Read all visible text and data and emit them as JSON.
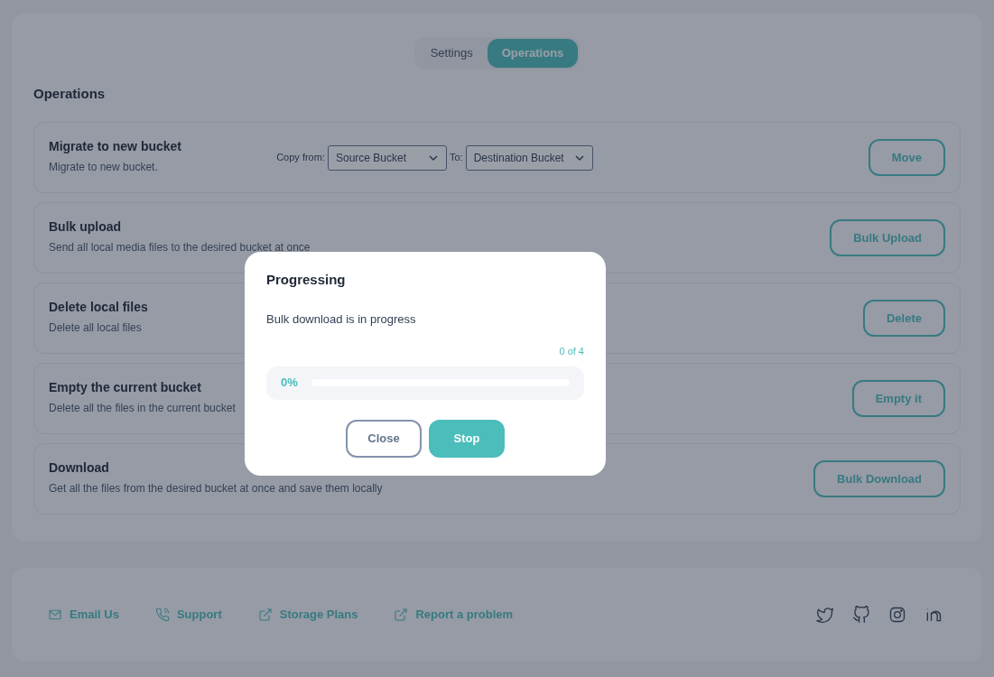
{
  "tabs": [
    {
      "label": "Settings",
      "selected": false
    },
    {
      "label": "Operations",
      "selected": true
    }
  ],
  "section_title": "Operations",
  "operations": [
    {
      "kind": "migrate",
      "title": "Migrate to new bucket",
      "description": "Migrate to new bucket.",
      "copy_label": "Copy from:",
      "from_value": "Source Bucket",
      "to_label": "To:",
      "to_value": "Destination Bucket",
      "button": "Move"
    },
    {
      "kind": "simple",
      "title": "Bulk upload",
      "description": "Send all local media files to the desired bucket at once",
      "button": "Bulk Upload"
    },
    {
      "kind": "simple",
      "title": "Delete local files",
      "description": "Delete all local files",
      "button": "Delete"
    },
    {
      "kind": "simple",
      "title": "Empty the current bucket",
      "description": "Delete all the files in the current bucket",
      "button": "Empty it"
    },
    {
      "kind": "simple",
      "title": "Download",
      "description": "Get all the files from the desired bucket at once and save them locally",
      "button": "Bulk Download"
    }
  ],
  "footer_links": [
    {
      "kind": "mail",
      "label": "Email Us"
    },
    {
      "kind": "phone",
      "label": "Support"
    },
    {
      "kind": "external",
      "label": "Storage Plans"
    },
    {
      "kind": "external",
      "label": "Report a problem"
    }
  ],
  "dialog": {
    "title": "Progressing",
    "message": "Bulk download is in progress",
    "count": "0 of 4",
    "percent": "0%",
    "level": 0,
    "buttons": [
      {
        "label": "Close",
        "kind": "secondary"
      },
      {
        "label": "Stop",
        "kind": "primary"
      }
    ]
  }
}
